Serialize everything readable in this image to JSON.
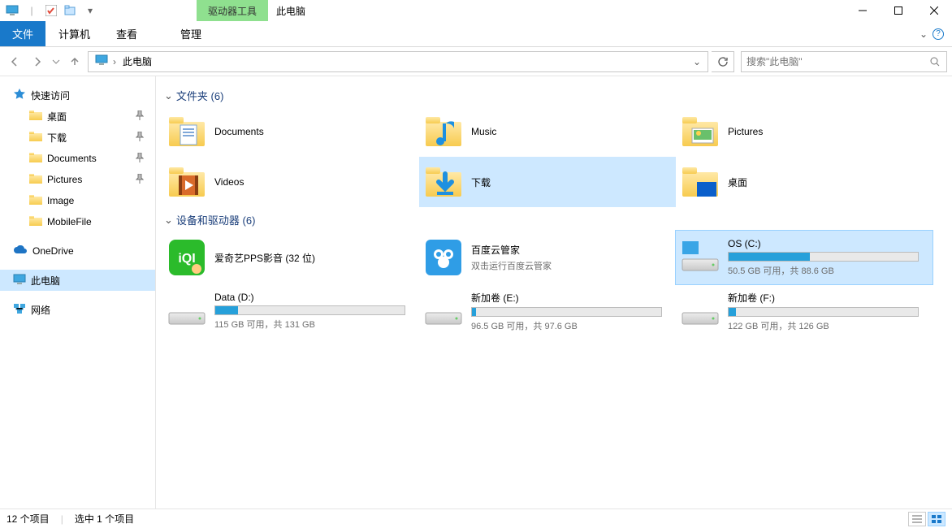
{
  "window": {
    "context_tool": "驱动器工具",
    "title": "此电脑"
  },
  "ribbon": {
    "file": "文件",
    "tabs": [
      "计算机",
      "查看"
    ],
    "manage": "管理"
  },
  "address": {
    "location": "此电脑",
    "search_placeholder": "搜索\"此电脑\""
  },
  "sidebar": {
    "quick_access": "快速访问",
    "quick_items": [
      {
        "label": "桌面",
        "pinned": true
      },
      {
        "label": "下载",
        "pinned": true
      },
      {
        "label": "Documents",
        "pinned": true
      },
      {
        "label": "Pictures",
        "pinned": true
      },
      {
        "label": "Image",
        "pinned": false
      },
      {
        "label": "MobileFile",
        "pinned": false
      }
    ],
    "onedrive": "OneDrive",
    "this_pc": "此电脑",
    "network": "网络"
  },
  "sections": {
    "folders_title": "文件夹 (6)",
    "devices_title": "设备和驱动器 (6)"
  },
  "folders": [
    {
      "label": "Documents",
      "kind": "documents"
    },
    {
      "label": "Music",
      "kind": "music"
    },
    {
      "label": "Pictures",
      "kind": "pictures"
    },
    {
      "label": "Videos",
      "kind": "videos"
    },
    {
      "label": "下载",
      "kind": "downloads",
      "selected": true
    },
    {
      "label": "桌面",
      "kind": "desktop"
    }
  ],
  "devices": [
    {
      "label": "爱奇艺PPS影音 (32 位)",
      "sub": "",
      "kind": "iqiyi"
    },
    {
      "label": "百度云管家",
      "sub": "双击运行百度云管家",
      "kind": "baidu"
    },
    {
      "label": "OS (C:)",
      "sub": "50.5 GB 可用，共 88.6 GB",
      "kind": "drive",
      "fill": 43,
      "selected": true,
      "os": true
    },
    {
      "label": "Data (D:)",
      "sub": "115 GB 可用，共 131 GB",
      "kind": "drive",
      "fill": 12
    },
    {
      "label": "新加卷 (E:)",
      "sub": "96.5 GB 可用，共 97.6 GB",
      "kind": "drive",
      "fill": 2
    },
    {
      "label": "新加卷 (F:)",
      "sub": "122 GB 可用，共 126 GB",
      "kind": "drive",
      "fill": 4
    }
  ],
  "status": {
    "count": "12 个项目",
    "selection": "选中 1 个项目"
  }
}
